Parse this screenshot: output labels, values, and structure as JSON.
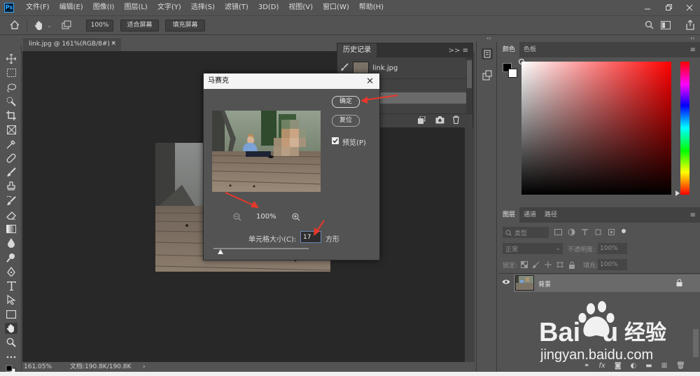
{
  "app": {
    "logo": "Ps"
  },
  "menu": [
    "文件(F)",
    "编辑(E)",
    "图像(I)",
    "图层(L)",
    "文字(Y)",
    "选择(S)",
    "滤镜(T)",
    "3D(D)",
    "视图(V)",
    "窗口(W)",
    "帮助(H)"
  ],
  "options": {
    "zoom": "100%",
    "fit_screen": "适合屏幕",
    "fill_screen": "填充屏幕"
  },
  "document": {
    "tab_title": "link.jpg @ 161%(RGB/8#) *",
    "status_zoom": "161.05%",
    "status_doc": "文档:190.8K/190.8K",
    "status_arrow": "›"
  },
  "history": {
    "title": "历史记录",
    "item": "link.jpg",
    "collapse": ">>"
  },
  "dialog": {
    "title": "马赛克",
    "ok": "确定",
    "reset": "复位",
    "preview_label": "预览(P)",
    "preview_checked": true,
    "zoom": "100%",
    "cell_label": "单元格大小(C):",
    "cell_value": "17",
    "cell_unit": "方形",
    "slider_value": 17
  },
  "color_panel": {
    "tabs": [
      "颜色",
      "色板"
    ],
    "collapse": "‹‹"
  },
  "layers_panel": {
    "tabs": [
      "图层",
      "通道",
      "路径"
    ],
    "filter_placeholder": "类型",
    "blend_mode": "正常",
    "opacity_label": "不透明度:",
    "opacity_value": "100%",
    "lock_label": "锁定:",
    "fill_label": "填充:",
    "fill_value": "100%",
    "layer_name": "背景"
  },
  "colors": {
    "accent_red": "#e8382b",
    "panel": "#535353",
    "dark": "#282828"
  }
}
